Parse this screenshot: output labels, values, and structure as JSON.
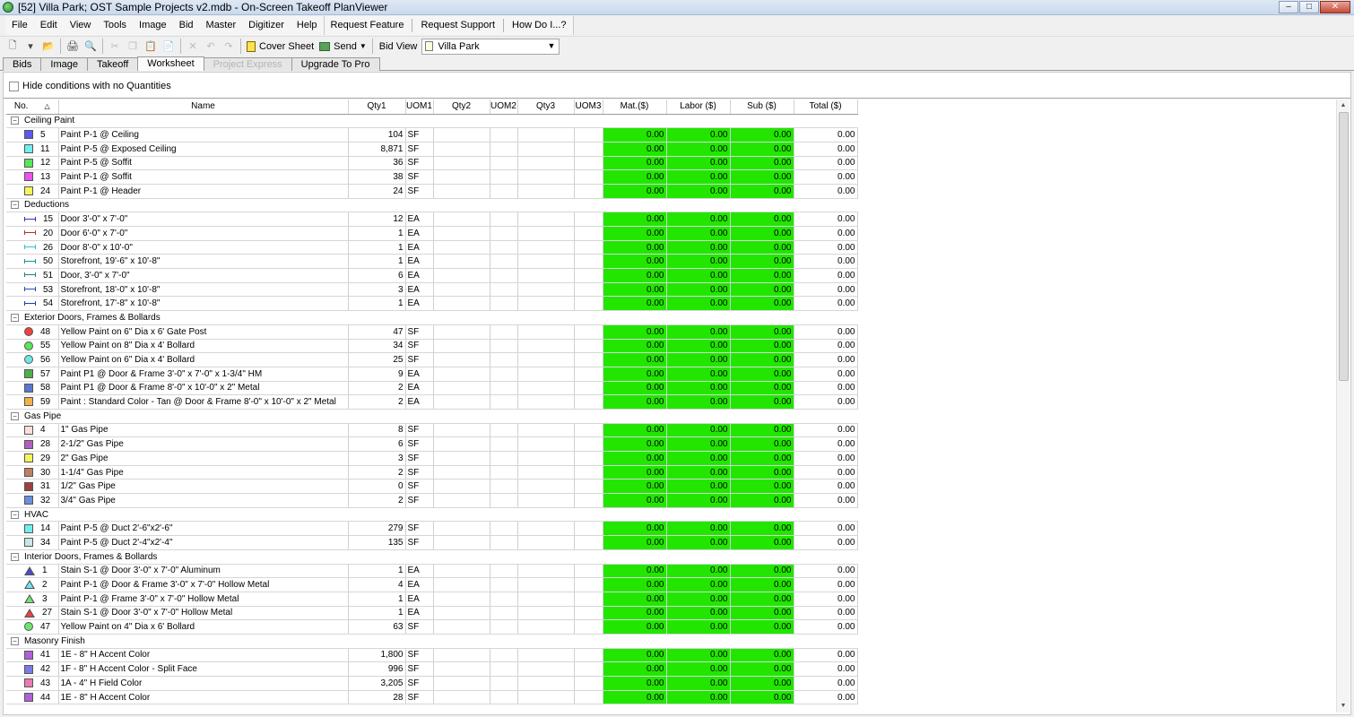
{
  "window": {
    "title": "[52] Villa Park; OST Sample Projects v2.mdb - On-Screen Takeoff PlanViewer",
    "min_glyph": "–",
    "max_glyph": "□",
    "close_glyph": "✕"
  },
  "menu": {
    "items": [
      "File",
      "Edit",
      "View",
      "Tools",
      "Image",
      "Bid",
      "Master",
      "Digitizer",
      "Help"
    ],
    "extra": [
      "Request Feature",
      "Request Support",
      "How Do I...?"
    ]
  },
  "toolbar": {
    "cover_sheet": "Cover Sheet",
    "send": "Send",
    "bid_view_label": "Bid View",
    "bid_view_value": "Villa Park"
  },
  "tabs": [
    {
      "label": "Bids",
      "state": "normal"
    },
    {
      "label": "Image",
      "state": "normal"
    },
    {
      "label": "Takeoff",
      "state": "normal"
    },
    {
      "label": "Worksheet",
      "state": "active"
    },
    {
      "label": "Project Express",
      "state": "disabled"
    },
    {
      "label": "Upgrade To Pro",
      "state": "normal"
    }
  ],
  "filter": {
    "hide_no_qty": "Hide conditions with no Quantities"
  },
  "colors": {
    "green_cell": "#22e600"
  },
  "columns": [
    "No.",
    "Name",
    "Qty1",
    "UOM1",
    "Qty2",
    "UOM2",
    "Qty3",
    "UOM3",
    "Mat.($)",
    "Labor ($)",
    "Sub ($)",
    "Total ($)"
  ],
  "groups": [
    {
      "name": "Ceiling Paint",
      "rows": [
        {
          "icon": "square",
          "color": "#5a5af0",
          "no": "5",
          "name": "Paint P-1 @ Ceiling",
          "qty1": "104",
          "uom1": "SF"
        },
        {
          "icon": "square",
          "color": "#6ef0f0",
          "no": "11",
          "name": "Paint P-5 @ Exposed Ceiling",
          "qty1": "8,871",
          "uom1": "SF"
        },
        {
          "icon": "square",
          "color": "#5ae65a",
          "no": "12",
          "name": "Paint P-5 @ Soffit",
          "qty1": "36",
          "uom1": "SF"
        },
        {
          "icon": "square",
          "color": "#f050f0",
          "no": "13",
          "name": "Paint P-1 @ Soffit",
          "qty1": "38",
          "uom1": "SF"
        },
        {
          "icon": "square",
          "color": "#f5f55a",
          "no": "24",
          "name": "Paint P-1 @ Header",
          "qty1": "24",
          "uom1": "SF"
        }
      ]
    },
    {
      "name": "Deductions",
      "rows": [
        {
          "icon": "line",
          "color": "#3030c0",
          "no": "15",
          "name": "Door 3'-0\" x 7'-0\"",
          "qty1": "12",
          "uom1": "EA"
        },
        {
          "icon": "line",
          "color": "#b03030",
          "no": "20",
          "name": "Door 6'-0\" x 7'-0\"",
          "qty1": "1",
          "uom1": "EA"
        },
        {
          "icon": "line",
          "color": "#30c0d0",
          "no": "26",
          "name": "Door 8'-0\" x 10'-0\"",
          "qty1": "1",
          "uom1": "EA"
        },
        {
          "icon": "line",
          "color": "#209090",
          "no": "50",
          "name": "Storefront, 19'-6\" x 10'-8\"",
          "qty1": "1",
          "uom1": "EA"
        },
        {
          "icon": "line",
          "color": "#208080",
          "no": "51",
          "name": "Door, 3'-0\" x 7'-0\"",
          "qty1": "6",
          "uom1": "EA"
        },
        {
          "icon": "line",
          "color": "#2050b0",
          "no": "53",
          "name": "Storefront, 18'-0\" x 10'-8\"",
          "qty1": "3",
          "uom1": "EA"
        },
        {
          "icon": "line",
          "color": "#2040a0",
          "no": "54",
          "name": "Storefront, 17'-8\" x 10'-8\"",
          "qty1": "1",
          "uom1": "EA"
        }
      ]
    },
    {
      "name": "Exterior Doors, Frames & Bollards",
      "rows": [
        {
          "icon": "circle",
          "color": "#f04040",
          "no": "48",
          "name": "Yellow Paint on 6\" Dia x 6' Gate Post",
          "qty1": "47",
          "uom1": "SF"
        },
        {
          "icon": "circle",
          "color": "#5ae65a",
          "no": "55",
          "name": "Yellow Paint on 8\" Dia x 4' Bollard",
          "qty1": "34",
          "uom1": "SF"
        },
        {
          "icon": "circle",
          "color": "#6ee6e6",
          "no": "56",
          "name": "Yellow Paint on 6\" Dia x 4' Bollard",
          "qty1": "25",
          "uom1": "SF"
        },
        {
          "icon": "square",
          "color": "#4cb04c",
          "no": "57",
          "name": "Paint P1 @ Door & Frame 3'-0\" x 7'-0\" x 1-3/4\" HM",
          "qty1": "9",
          "uom1": "EA"
        },
        {
          "icon": "square",
          "color": "#5a78d0",
          "no": "58",
          "name": "Paint P1 @ Door & Frame 8'-0\" x 10'-0\" x 2\" Metal",
          "qty1": "2",
          "uom1": "EA"
        },
        {
          "icon": "square",
          "color": "#f5b04a",
          "no": "59",
          "name": "Paint : Standard Color - Tan @ Door & Frame 8'-0\" x 10'-0\" x 2\" Metal",
          "qty1": "2",
          "uom1": "EA"
        }
      ]
    },
    {
      "name": "Gas Pipe",
      "rows": [
        {
          "icon": "square",
          "color": "#fbe0e0",
          "no": "4",
          "name": "1\" Gas Pipe",
          "qty1": "8",
          "uom1": "SF"
        },
        {
          "icon": "square",
          "color": "#b060c0",
          "no": "28",
          "name": "2-1/2\" Gas Pipe",
          "qty1": "6",
          "uom1": "SF"
        },
        {
          "icon": "square",
          "color": "#f5f55a",
          "no": "29",
          "name": "2\" Gas Pipe",
          "qty1": "3",
          "uom1": "SF"
        },
        {
          "icon": "square",
          "color": "#c08060",
          "no": "30",
          "name": "1-1/4\" Gas Pipe",
          "qty1": "2",
          "uom1": "SF"
        },
        {
          "icon": "square",
          "color": "#a04040",
          "no": "31",
          "name": "1/2\" Gas Pipe",
          "qty1": "0",
          "uom1": "SF"
        },
        {
          "icon": "square",
          "color": "#6a8ee0",
          "no": "32",
          "name": "3/4\" Gas Pipe",
          "qty1": "2",
          "uom1": "SF"
        }
      ]
    },
    {
      "name": "HVAC",
      "rows": [
        {
          "icon": "square",
          "color": "#6ef0f0",
          "no": "14",
          "name": "Paint P-5 @ Duct 2'-6\"x2'-6\"",
          "qty1": "279",
          "uom1": "SF"
        },
        {
          "icon": "square",
          "color": "#c8e8e8",
          "no": "34",
          "name": "Paint P-5 @ Duct 2'-4\"x2'-4\"",
          "qty1": "135",
          "uom1": "SF"
        }
      ]
    },
    {
      "name": "Interior Doors, Frames & Bollards",
      "rows": [
        {
          "icon": "triangle",
          "color": "#4a4ad0",
          "no": "1",
          "name": "Stain S-1 @ Door 3'-0\" x 7'-0\" Aluminum",
          "qty1": "1",
          "uom1": "EA"
        },
        {
          "icon": "triangle",
          "color": "#6ee6f0",
          "no": "2",
          "name": "Paint P-1 @ Door & Frame 3'-0\" x 7'-0\" Hollow Metal",
          "qty1": "4",
          "uom1": "EA"
        },
        {
          "icon": "triangle",
          "color": "#6ee66e",
          "no": "3",
          "name": "Paint P-1 @ Frame 3'-0\" x 7'-0\" Hollow Metal",
          "qty1": "1",
          "uom1": "EA"
        },
        {
          "icon": "triangle",
          "color": "#f04040",
          "no": "27",
          "name": "Stain S-1 @ Door 3'-0\" x 7'-0\" Hollow Metal",
          "qty1": "1",
          "uom1": "EA"
        },
        {
          "icon": "circle",
          "color": "#6ee66e",
          "no": "47",
          "name": "Yellow Paint on 4\" Dia x 6' Bollard",
          "qty1": "63",
          "uom1": "SF"
        }
      ]
    },
    {
      "name": "Masonry Finish",
      "rows": [
        {
          "icon": "square",
          "color": "#b060d8",
          "no": "41",
          "name": "1E - 8\" H Accent Color",
          "qty1": "1,800",
          "uom1": "SF"
        },
        {
          "icon": "square",
          "color": "#7a7ae8",
          "no": "42",
          "name": "1F - 8\" H Accent Color - Split Face",
          "qty1": "996",
          "uom1": "SF"
        },
        {
          "icon": "square",
          "color": "#f07ab0",
          "no": "43",
          "name": "1A - 4\" H Field Color",
          "qty1": "3,205",
          "uom1": "SF"
        },
        {
          "icon": "square",
          "color": "#b060d8",
          "no": "44",
          "name": "1E - 8\" H Accent Color",
          "qty1": "28",
          "uom1": "SF"
        }
      ]
    }
  ],
  "money_zero": "0.00"
}
